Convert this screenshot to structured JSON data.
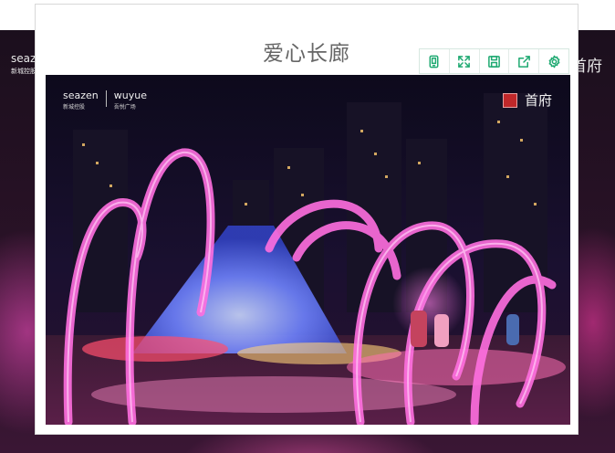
{
  "background": {
    "brand_left": "seazen",
    "brand_left_sub": "新城控股",
    "brand_right": "首府"
  },
  "lightbox": {
    "title": "爱心长廊",
    "toolbar": [
      {
        "icon": "phone-icon",
        "name": "mobile-view-button"
      },
      {
        "icon": "fullscreen-icon",
        "name": "fullscreen-button"
      },
      {
        "icon": "save-icon",
        "name": "save-button"
      },
      {
        "icon": "share-icon",
        "name": "share-button"
      },
      {
        "icon": "gear-icon",
        "name": "settings-button"
      }
    ],
    "accent_color": "#1ea971"
  },
  "photo": {
    "brand_seazen": "seazen",
    "brand_seazen_sub": "新城控股",
    "brand_wuyue": "wuyue",
    "brand_wuyue_sub": "吾悦广场",
    "brand_right": "首府"
  }
}
